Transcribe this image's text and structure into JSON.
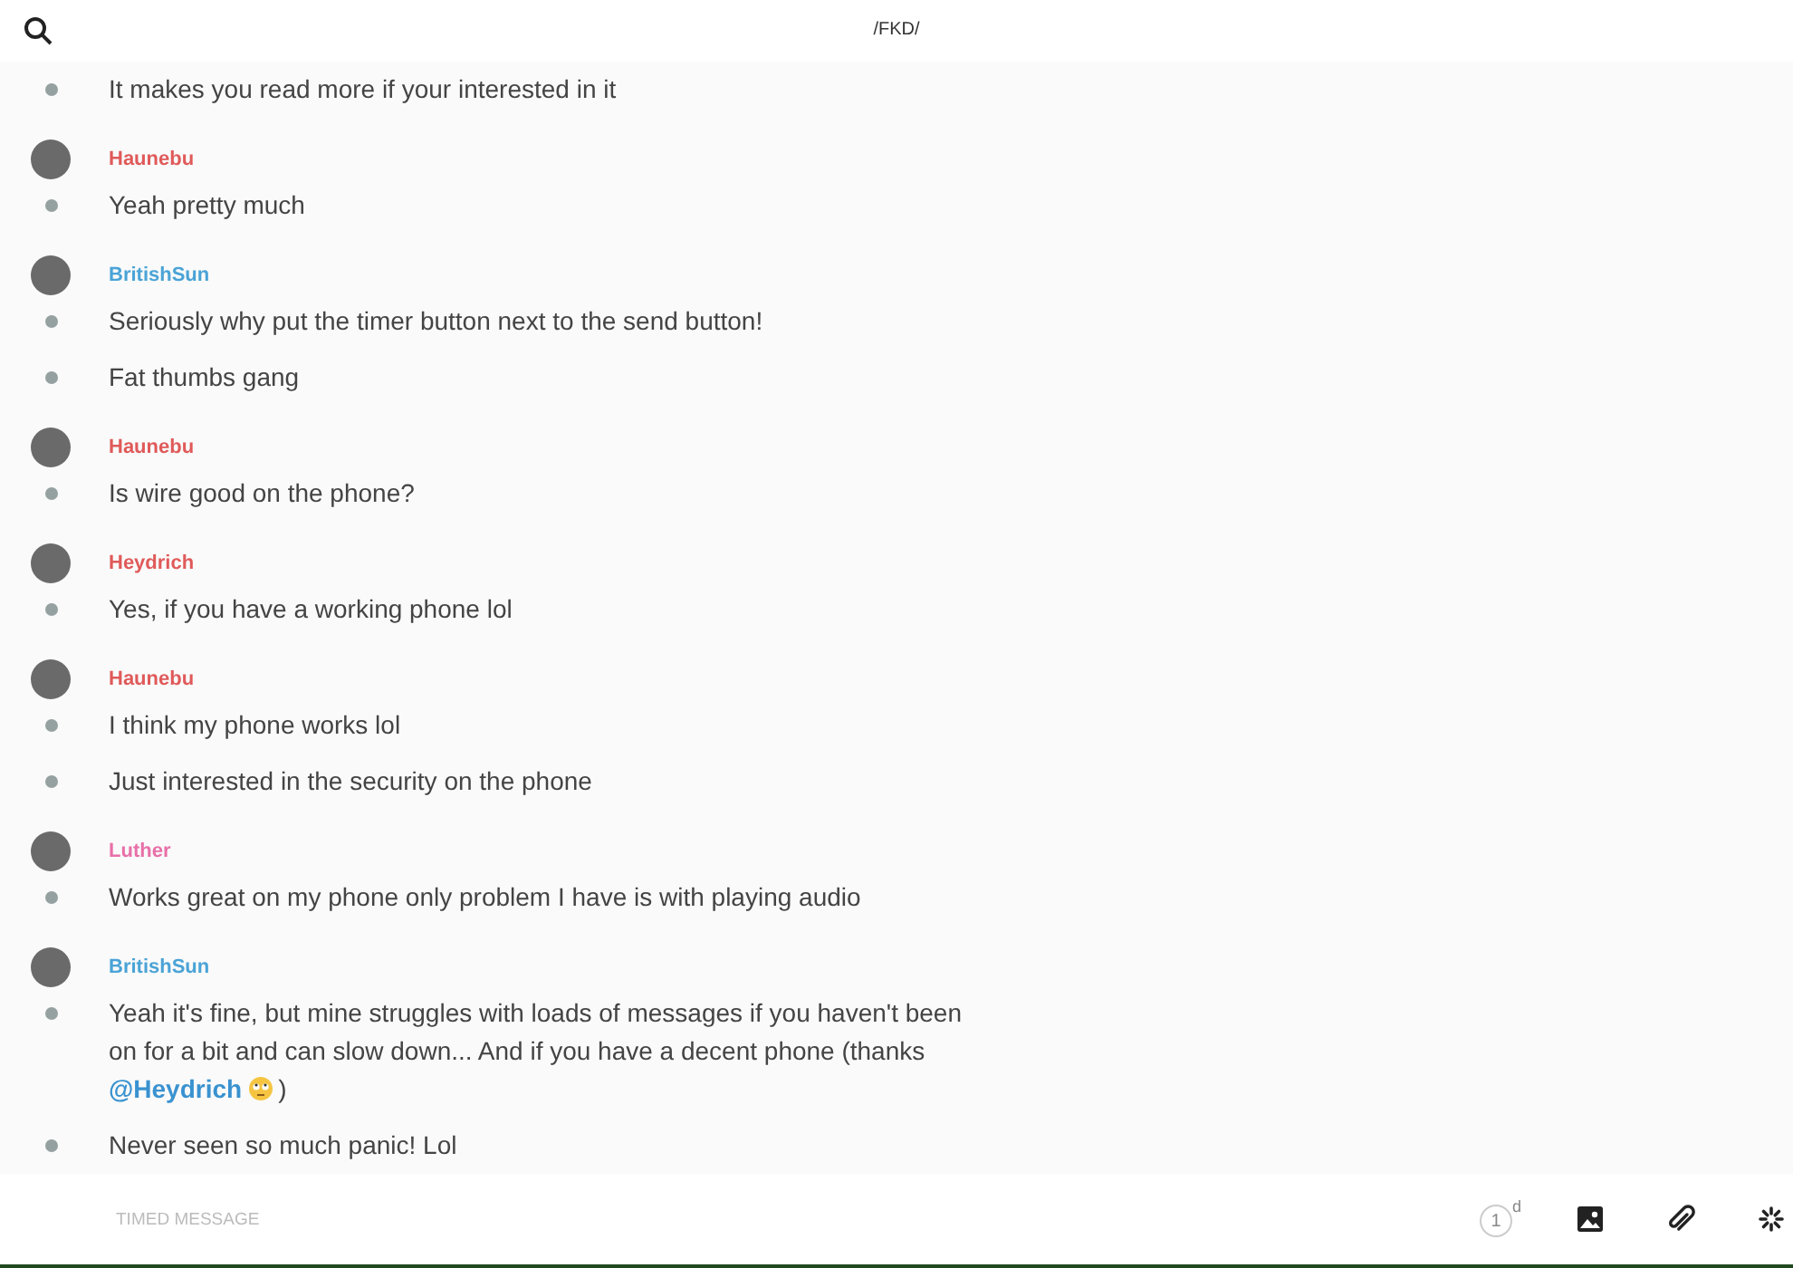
{
  "header": {
    "title": "/FKD/"
  },
  "messages": [
    {
      "lines": [
        {
          "text": "It makes you read more if your interested in it"
        }
      ]
    },
    {
      "author": "Haunebu",
      "color": "#e05a5a",
      "lines": [
        {
          "text": "Yeah pretty much"
        }
      ]
    },
    {
      "author": "BritishSun",
      "color": "#4aa3d6",
      "lines": [
        {
          "text": "Seriously why put the timer button next to the send button!"
        },
        {
          "text": "Fat thumbs gang"
        }
      ]
    },
    {
      "author": "Haunebu",
      "color": "#e05a5a",
      "lines": [
        {
          "text": "Is wire good on the phone?"
        }
      ]
    },
    {
      "author": "Heydrich",
      "color": "#e05a5a",
      "lines": [
        {
          "text": "Yes, if you have a working phone lol"
        }
      ]
    },
    {
      "author": "Haunebu",
      "color": "#e05a5a",
      "lines": [
        {
          "text": "I think my phone works lol"
        },
        {
          "text": "Just interested in the security on the phone"
        }
      ]
    },
    {
      "author": "Luther",
      "color": "#e870a8",
      "lines": [
        {
          "text": "Works great on my phone only problem I have is with playing audio"
        }
      ]
    },
    {
      "author": "BritishSun",
      "color": "#4aa3d6",
      "lines": [
        {
          "text": "Yeah it's fine, but mine struggles with loads of messages if you haven't been on for a bit and can slow down... And if you have a decent phone (thanks",
          "mention": "@Heydrich",
          "after": ")"
        },
        {
          "text": "Never seen so much panic! Lol"
        }
      ]
    }
  ],
  "composer": {
    "placeholder": "TIMED MESSAGE",
    "timer": "1",
    "timer_unit": "d"
  }
}
